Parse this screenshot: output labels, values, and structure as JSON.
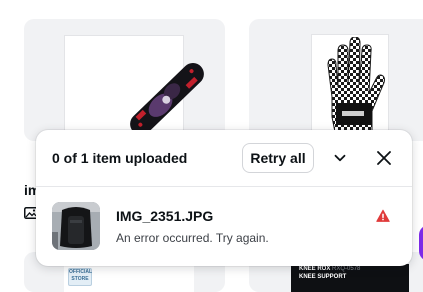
{
  "background": {
    "partial_label": "im",
    "image_type_icon": "image-icon",
    "store_badge_text": "OFFICIAL STORE",
    "product_title": "KNEE ROX",
    "product_code": "RXQ-0578",
    "product_subtitle": "KNEE SUPPORT"
  },
  "upload_panel": {
    "status_text": "0 of 1 item uploaded",
    "retry_all_label": "Retry all",
    "collapse_icon": "chevron-down-icon",
    "close_icon": "close-icon",
    "files": [
      {
        "name": "IMG_2351.JPG",
        "message": "An error occurred. Try again.",
        "status_icon": "warning-icon"
      }
    ]
  },
  "colors": {
    "error": "#e03b3b",
    "brand_purple": "#7d2ae8",
    "card_bg": "#f1f2f4"
  }
}
